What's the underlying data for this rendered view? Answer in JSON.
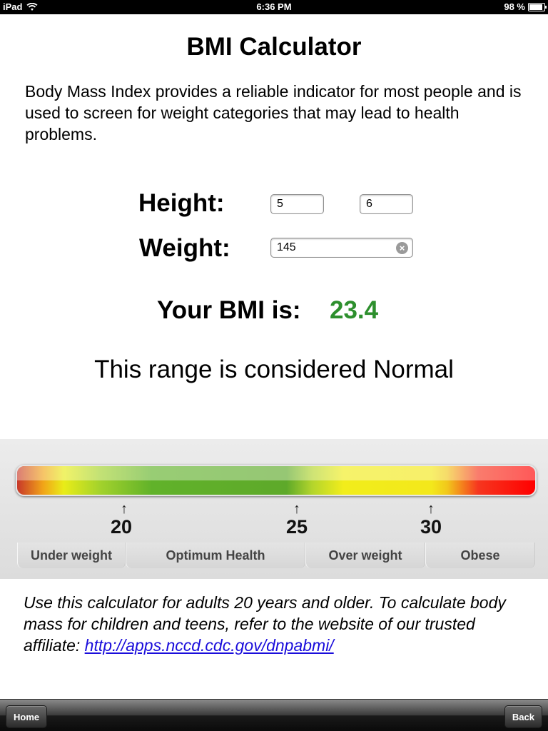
{
  "status_bar": {
    "device": "iPad",
    "time": "6:36 PM",
    "battery": "98 %",
    "battery_level": 0.98
  },
  "title": "BMI Calculator",
  "intro": "Body Mass Index provides a reliable indicator for most people and is used to screen for weight categories that may lead to health problems.",
  "form": {
    "height_label": "Height:",
    "height_feet": "5",
    "height_inches": "6",
    "weight_label": "Weight:",
    "weight_value": "145"
  },
  "result": {
    "label": "Your BMI is:",
    "value": "23.4",
    "value_color": "#2d8f2d",
    "range_text": "This range is considered Normal"
  },
  "gauge": {
    "ticks": [
      "20",
      "25",
      "30"
    ],
    "categories": [
      "Under weight",
      "Optimum Health",
      "Over weight",
      "Obese"
    ]
  },
  "footer": {
    "note": "Use this calculator for adults 20 years and older.  To calculate body mass for children and teens, refer to the website of our trusted affiliate: ",
    "link": "http://apps.nccd.cdc.gov/dnpabmi/"
  },
  "toolbar": {
    "home_label": "Home",
    "back_label": "Back"
  }
}
